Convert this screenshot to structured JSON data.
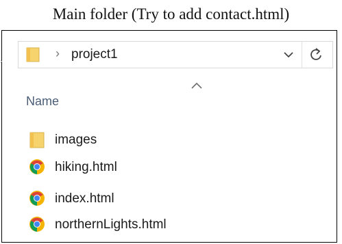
{
  "caption": "Main folder (Try to add contact.html)",
  "address_bar": {
    "breadcrumb_separator": "›",
    "path": "project1",
    "dropdown_icon": "chevron-down-icon",
    "refresh_icon": "refresh-icon"
  },
  "column_header": {
    "name": "Name",
    "sort_icon": "sort-up-icon"
  },
  "files": [
    {
      "name": "images",
      "type": "folder",
      "icon": "folder-icon"
    },
    {
      "name": "hiking.html",
      "type": "html",
      "icon": "chrome-icon"
    },
    {
      "name": "index.html",
      "type": "html",
      "icon": "chrome-icon"
    },
    {
      "name": "northernLights.html",
      "type": "html",
      "icon": "chrome-icon"
    }
  ],
  "colors": {
    "folder": "#F7D36E",
    "chrome_red": "#DB4437",
    "chrome_yellow": "#F4B400",
    "chrome_green": "#0F9D58",
    "chrome_blue": "#4285F4"
  }
}
